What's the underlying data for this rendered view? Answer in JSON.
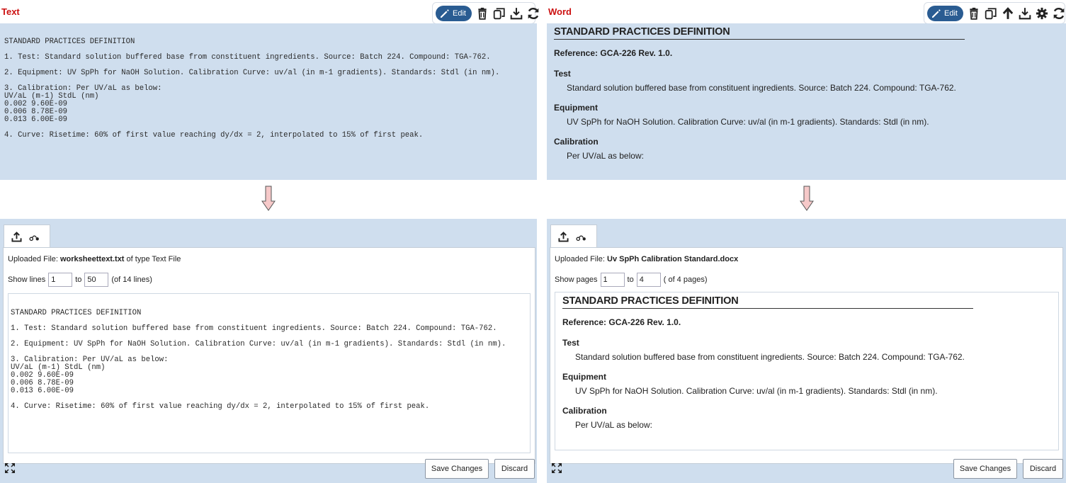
{
  "left": {
    "title": "Text",
    "toolbar": {
      "edit_label": "Edit"
    },
    "preview_lines": [
      "",
      "STANDARD PRACTICES DEFINITION",
      "",
      "1. Test: Standard solution buffered base from constituent ingredients. Source: Batch 224. Compound: TGA-762.",
      "",
      "2. Equipment: UV SpPh for NaOH Solution. Calibration Curve: uv/al (in m-1 gradients). Standards: Stdl (in nm).",
      "",
      "3. Calibration: Per UV/aL as below:",
      "UV/aL (m-1) StdL (nm)",
      "0.002 9.60E-09",
      "0.006 8.78E-09",
      "0.013 6.00E-09",
      "",
      "4. Curve: Risetime: 60% of first value reaching dy/dx = 2, interpolated to 15% of first peak."
    ],
    "uploaded": {
      "prefix": "Uploaded File: ",
      "file": "worksheettext.txt",
      "suffix": " of type Text File"
    },
    "range": {
      "label": "Show lines",
      "from": "1",
      "to_label": "to",
      "to": "50",
      "total": "(of 14 lines)"
    },
    "buttons": {
      "save": "Save Changes",
      "discard": "Discard"
    }
  },
  "right": {
    "title": "Word",
    "toolbar": {
      "edit_label": "Edit"
    },
    "doc": {
      "heading": "STANDARD PRACTICES DEFINITION",
      "reference": "Reference:  GCA-226  Rev. 1.0.",
      "test_title": "Test",
      "test_body": "Standard solution buffered base from constituent ingredients.  Source: Batch 224.   Compound: TGA-762.",
      "equip_title": "Equipment",
      "equip_body": "UV SpPh for NaOH Solution.  Calibration Curve:  uv/al (in m-1 gradients).  Standards: Stdl (in nm).",
      "calib_title": "Calibration",
      "calib_body": "Per UV/aL  as below:"
    },
    "uploaded": {
      "prefix": "Uploaded File: ",
      "file": "Uv SpPh Calibration Standard.docx"
    },
    "range": {
      "label": "Show pages",
      "from": "1",
      "to_label": "to",
      "to": "4",
      "total": "( of 4 pages)"
    },
    "buttons": {
      "save": "Save Changes",
      "discard": "Discard"
    }
  },
  "icons": {
    "edit": "pencil-icon",
    "delete": "trash-icon",
    "copy": "copy-icon",
    "download": "download-icon",
    "refresh": "refresh-icon",
    "up": "arrow-up-icon",
    "settings": "gear-icon",
    "upload": "upload-icon",
    "link": "link-icon",
    "expand": "expand-icon",
    "flow": "down-arrow-icon"
  },
  "colors": {
    "panel_bg": "#cfdeee",
    "title_red": "#cc1111",
    "edit_blue": "#2a5c92",
    "arrow_fill": "#f6c9c9"
  }
}
